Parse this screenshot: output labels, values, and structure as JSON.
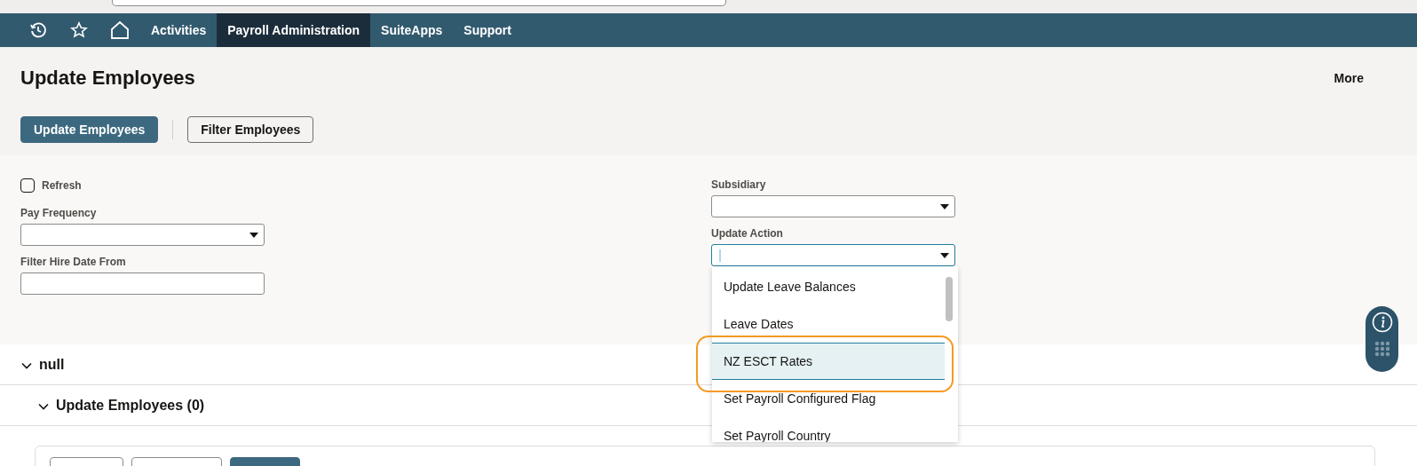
{
  "nav": {
    "items": [
      {
        "label": "Activities",
        "selected": false
      },
      {
        "label": "Payroll Administration",
        "selected": true
      },
      {
        "label": "SuiteApps",
        "selected": false
      },
      {
        "label": "Support",
        "selected": false
      }
    ]
  },
  "page": {
    "title": "Update Employees",
    "more": "More",
    "buttons": [
      {
        "label": "Update Employees",
        "kind": "primary"
      },
      {
        "label": "Filter Employees",
        "kind": "secondary"
      }
    ]
  },
  "form": {
    "refresh": {
      "label": "Refresh",
      "checked": false
    },
    "pay_frequency": {
      "label": "Pay Frequency"
    },
    "filter_hire_date_from": {
      "label": "Filter Hire Date From"
    },
    "subsidiary": {
      "label": "Subsidiary"
    },
    "update_action": {
      "label": "Update Action",
      "focused": true,
      "options": [
        {
          "label": "Update Leave Balances",
          "selected": false,
          "circled": false
        },
        {
          "label": "Leave Dates",
          "selected": false,
          "circled": false
        },
        {
          "label": "NZ ESCT Rates",
          "selected": true,
          "circled": true
        },
        {
          "label": "Set Payroll Configured Flag",
          "selected": false,
          "circled": false
        },
        {
          "label": "Set Payroll Country",
          "selected": false,
          "circled": false
        }
      ]
    }
  },
  "sections": [
    {
      "title": "null",
      "expanded": true
    },
    {
      "title": "Update Employees (0)",
      "expanded": true
    }
  ],
  "sublist_toolbar": {
    "buttons": [
      {
        "kind": "secondary"
      },
      {
        "kind": "secondary"
      },
      {
        "kind": "primary"
      }
    ]
  }
}
